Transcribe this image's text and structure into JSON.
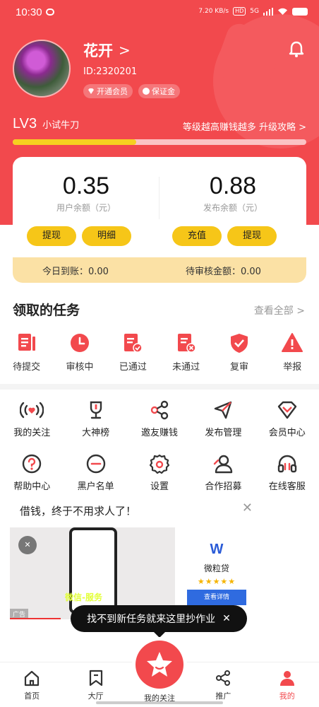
{
  "status": {
    "time": "10:30",
    "speed": "7.20 KB/s",
    "network": "5G",
    "hd": "HD"
  },
  "user": {
    "name": "花开",
    "name_chevron": ">",
    "id": "ID:2320201",
    "badges": [
      "开通会员",
      "保证金"
    ]
  },
  "level": {
    "lv": "LV3",
    "name": "小试牛刀",
    "link": "等级越高赚钱越多 升级攻略 >",
    "progress_fraction": 0.42
  },
  "balance": {
    "user_amount": "0.35",
    "user_label": "用户余额（元）",
    "publish_amount": "0.88",
    "publish_label": "发布余额（元）",
    "buttons": [
      "提现",
      "明细",
      "充值",
      "提现"
    ],
    "today": "今日到账：0.00",
    "pending": "待审核金额：0.00"
  },
  "tasks": {
    "title": "领取的任务",
    "more": "查看全部 >",
    "items": [
      "待提交",
      "审核中",
      "已通过",
      "未通过",
      "复审",
      "举报"
    ]
  },
  "grid": {
    "row1": [
      "我的关注",
      "大神榜",
      "邀友赚钱",
      "发布管理",
      "会员中心"
    ],
    "row2": [
      "帮助中心",
      "黑户名单",
      "设置",
      "合作招募",
      "在线客服"
    ]
  },
  "ad": {
    "title": "借钱，终于不用求人了！",
    "close": "✕",
    "caption": "微信-服务",
    "tag": "广告",
    "brand": "微粒贷",
    "stars": "★★★★★",
    "cta": "查看详情"
  },
  "tooltip": {
    "text": "找不到新任务就来这里抄作业",
    "close": "✕"
  },
  "tabs": [
    "首页",
    "大厅",
    "我的关注",
    "推广",
    "我的"
  ],
  "colors": {
    "primary": "#f2494d",
    "accent": "#f6c618",
    "today_bg": "#fbe1a5"
  }
}
